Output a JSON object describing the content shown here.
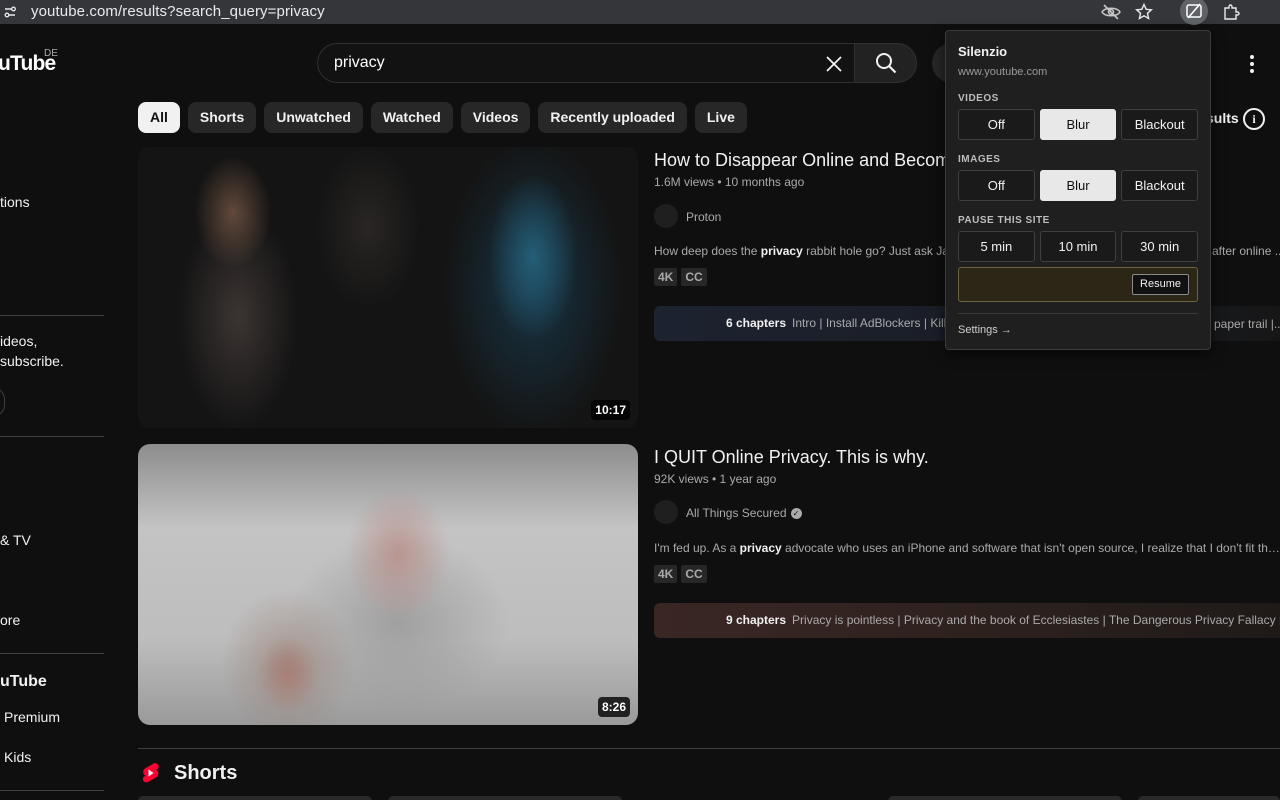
{
  "browser": {
    "url": "youtube.com/results?search_query=privacy",
    "icons": [
      "site-info-icon",
      "eye-off-icon",
      "star-icon",
      "extension-silenzio-icon",
      "puzzle-icon"
    ]
  },
  "youtube": {
    "logo": "uTube",
    "region": "DE",
    "search_value": "privacy",
    "sidebar": {
      "fragment_subscriptions": "tions",
      "signin_line1": "ideos,",
      "signin_line2": "subscribe.",
      "fragment_movies": "& TV",
      "fragment_more": "ore",
      "heading_more_from": "uTube",
      "fragment_premium": "Premium",
      "fragment_kids": "Kids"
    },
    "chips": [
      "All",
      "Shorts",
      "Unwatched",
      "Watched",
      "Videos",
      "Recently uploaded",
      "Live"
    ],
    "results_label": "sults",
    "videos": [
      {
        "title": "How to Disappear Online and Becom",
        "meta": "1.6M views • 10 months ago",
        "channel": "Proton",
        "desc_before": "How deep does the ",
        "desc_bold": "privacy",
        "desc_after": " rabbit hole go? Just ask Ja",
        "desc_tail": "after online ...",
        "badges": [
          "4K",
          "CC"
        ],
        "chapters_count": "6 chapters",
        "chapters_text": "Intro | Install AdBlockers | Kill",
        "chapters_tail": "paper trail |...",
        "duration": "10:17"
      },
      {
        "title": "I QUIT Online Privacy. This is why.",
        "meta": "92K views • 1 year ago",
        "channel": "All Things Secured",
        "verified": true,
        "desc_before": "I'm fed up. As a ",
        "desc_bold": "privacy",
        "desc_after": " advocate who uses an iPhone and software that isn't open source, I realize that I don't fit the ex",
        "badges": [
          "4K",
          "CC"
        ],
        "chapters_count": "9 chapters",
        "chapters_text": "Privacy is pointless | Privacy and the book of Ecclesiastes | The Dangerous Privacy Fallacy | F",
        "duration": "8:26"
      }
    ],
    "shorts_title": "Shorts"
  },
  "popup": {
    "title": "Silenzio",
    "site": "www.youtube.com",
    "videos_label": "VIDEOS",
    "images_label": "IMAGES",
    "mode_options": [
      "Off",
      "Blur",
      "Blackout"
    ],
    "videos_selected": "Blur",
    "images_selected": "Blur",
    "pause_label": "PAUSE THIS SITE",
    "pause_options": [
      "5 min",
      "10 min",
      "30 min"
    ],
    "resume_label": "Resume",
    "settings_link": "Settings →"
  }
}
